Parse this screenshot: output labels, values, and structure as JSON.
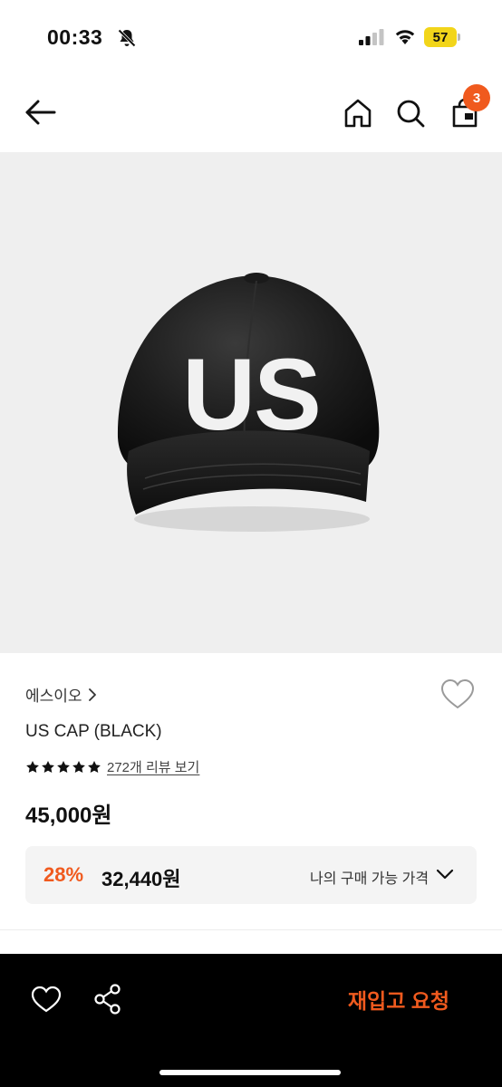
{
  "status_bar": {
    "time": "00:33",
    "battery": "57"
  },
  "nav": {
    "cart_count": "3"
  },
  "product": {
    "image_text": "US",
    "brand": "에스이오",
    "name": "US CAP (BLACK)",
    "rating": 5,
    "review_link": "272개 리뷰 보기",
    "price": "45,000원"
  },
  "discount": {
    "rate": "28%",
    "price": "32,440원",
    "my_price_label": "나의 구매 가능 가격"
  },
  "bottom_bar": {
    "restock_label": "재입고 요청"
  },
  "colors": {
    "accent": "#f05a1e",
    "image_bg": "#efefef",
    "bottom_bar_bg": "#000000",
    "battery": "#f2d51a"
  },
  "icons": [
    "bell-off-icon",
    "signal-icon",
    "wifi-icon",
    "battery-icon",
    "back-arrow-icon",
    "home-icon",
    "search-icon",
    "shopping-bag-icon",
    "chevron-right-icon",
    "heart-icon",
    "star-icon",
    "chevron-down-icon",
    "share-icon"
  ]
}
